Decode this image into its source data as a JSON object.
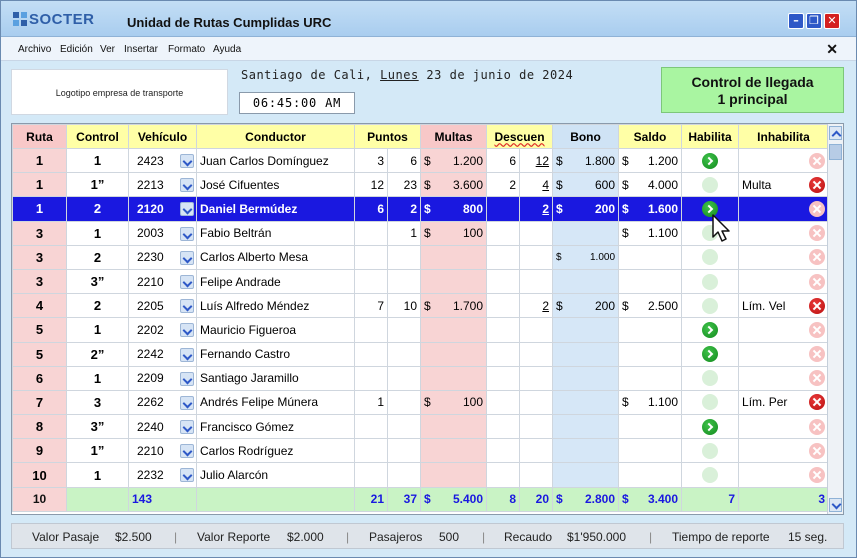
{
  "app": {
    "brand": "SOCTER",
    "title": "Unidad de Rutas Cumplidas URC",
    "window_controls": [
      "minimize",
      "maximize",
      "close"
    ]
  },
  "menu": [
    "Archivo",
    "Edición",
    "Ver",
    "Insertar",
    "Formato",
    "Ayuda"
  ],
  "header": {
    "company_logo_placeholder": "Logotipo empresa de transporte",
    "city": "Santiago de Cali,",
    "weekday": "Lunes",
    "date": "23 de junio de 2024",
    "time": "06:45:00 AM",
    "control_title_line1": "Control de llegada",
    "control_title_line2": "1 principal"
  },
  "table": {
    "columns": [
      "Ruta",
      "Control",
      "Vehículo",
      "Conductor",
      "Puntos",
      "Multas",
      "Descuen",
      "Bono",
      "Saldo",
      "Habilita",
      "Inhabilita"
    ],
    "currency_symbol": "$",
    "rows": [
      {
        "ruta": "1",
        "control": "1",
        "vehiculo": "2423",
        "conductor": "Juan Carlos Domínguez",
        "p1": "3",
        "p2": "6",
        "multa": "1.200",
        "d1": "6",
        "d2": "12",
        "bono": "1.800",
        "saldo": "1.200",
        "habilita": "on",
        "inh_text": "",
        "inh": "off"
      },
      {
        "ruta": "1",
        "control": "1”",
        "vehiculo": "2213",
        "conductor": "José Cifuentes",
        "p1": "12",
        "p2": "23",
        "multa": "3.600",
        "d1": "2",
        "d2": "4",
        "bono": "600",
        "saldo": "4.000",
        "habilita": "off",
        "inh_text": "Multa",
        "inh": "on"
      },
      {
        "ruta": "1",
        "control": "2",
        "vehiculo": "2120",
        "conductor": "Daniel Bermúdez",
        "p1": "6",
        "p2": "2",
        "multa": "800",
        "d1": "",
        "d2": "2",
        "bono": "200",
        "saldo": "1.600",
        "habilita": "on",
        "inh_text": "",
        "inh": "off",
        "selected": true
      },
      {
        "ruta": "3",
        "control": "1",
        "vehiculo": "2003",
        "conductor": "Fabio Beltrán",
        "p1": "",
        "p2": "1",
        "multa": "100",
        "d1": "",
        "d2": "",
        "bono": "",
        "saldo": "1.100",
        "habilita": "off",
        "inh_text": "",
        "inh": "off"
      },
      {
        "ruta": "3",
        "control": "2",
        "vehiculo": "2230",
        "conductor": "Carlos Alberto Mesa",
        "p1": "",
        "p2": "",
        "multa": "",
        "d1": "",
        "d2": "",
        "bono": "1.000",
        "saldo": "",
        "habilita": "off",
        "inh_text": "",
        "inh": "off"
      },
      {
        "ruta": "3",
        "control": "3”",
        "vehiculo": "2210",
        "conductor": "Felipe Andrade",
        "p1": "",
        "p2": "",
        "multa": "",
        "d1": "",
        "d2": "",
        "bono": "",
        "saldo": "",
        "habilita": "off",
        "inh_text": "",
        "inh": "off"
      },
      {
        "ruta": "4",
        "control": "2",
        "vehiculo": "2205",
        "conductor": "Luís Alfredo Méndez",
        "p1": "7",
        "p2": "10",
        "multa": "1.700",
        "d1": "",
        "d2": "2",
        "bono": "200",
        "saldo": "2.500",
        "habilita": "off",
        "inh_text": "Lím. Vel",
        "inh": "on"
      },
      {
        "ruta": "5",
        "control": "1",
        "vehiculo": "2202",
        "conductor": "Mauricio Figueroa",
        "p1": "",
        "p2": "",
        "multa": "",
        "d1": "",
        "d2": "",
        "bono": "",
        "saldo": "",
        "habilita": "on",
        "inh_text": "",
        "inh": "off"
      },
      {
        "ruta": "5",
        "control": "2”",
        "vehiculo": "2242",
        "conductor": "Fernando Castro",
        "p1": "",
        "p2": "",
        "multa": "",
        "d1": "",
        "d2": "",
        "bono": "",
        "saldo": "",
        "habilita": "on",
        "inh_text": "",
        "inh": "off"
      },
      {
        "ruta": "6",
        "control": "1",
        "vehiculo": "2209",
        "conductor": "Santiago Jaramillo",
        "p1": "",
        "p2": "",
        "multa": "",
        "d1": "",
        "d2": "",
        "bono": "",
        "saldo": "",
        "habilita": "off",
        "inh_text": "",
        "inh": "off"
      },
      {
        "ruta": "7",
        "control": "3",
        "vehiculo": "2262",
        "conductor": "Andrés Felipe Múnera",
        "p1": "1",
        "p2": "",
        "multa": "100",
        "d1": "",
        "d2": "",
        "bono": "",
        "saldo": "1.100",
        "habilita": "off",
        "inh_text": "Lím. Per",
        "inh": "on"
      },
      {
        "ruta": "8",
        "control": "3”",
        "vehiculo": "2240",
        "conductor": "Francisco Gómez",
        "p1": "",
        "p2": "",
        "multa": "",
        "d1": "",
        "d2": "",
        "bono": "",
        "saldo": "",
        "habilita": "on",
        "inh_text": "",
        "inh": "off"
      },
      {
        "ruta": "9",
        "control": "1”",
        "vehiculo": "2210",
        "conductor": "Carlos Rodríguez",
        "p1": "",
        "p2": "",
        "multa": "",
        "d1": "",
        "d2": "",
        "bono": "",
        "saldo": "",
        "habilita": "off",
        "inh_text": "",
        "inh": "off"
      },
      {
        "ruta": "10",
        "control": "1",
        "vehiculo": "2232",
        "conductor": "Julio Alarcón",
        "p1": "",
        "p2": "",
        "multa": "",
        "d1": "",
        "d2": "",
        "bono": "",
        "saldo": "",
        "habilita": "off",
        "inh_text": "",
        "inh": "off"
      }
    ],
    "totals": {
      "ruta": "10",
      "vehiculo": "143",
      "p1": "21",
      "p2": "37",
      "multa": "5.400",
      "d1": "8",
      "d2": "20",
      "bono": "2.800",
      "saldo": "3.400",
      "habilita": "7",
      "inhabilita": "3"
    }
  },
  "status": {
    "pasaje_label": "Valor Pasaje",
    "pasaje_value": "$2.500",
    "reporte_label": "Valor Reporte",
    "reporte_value": "$2.000",
    "pasajeros_label": "Pasajeros",
    "pasajeros_value": "500",
    "recaudo_label": "Recaudo",
    "recaudo_value": "$1'950.000",
    "tiempo_label": "Tiempo de reporte",
    "tiempo_value": "15 seg."
  },
  "colors": {
    "selected_row": "#1a18e0",
    "header_yellow": "#ffffa6",
    "ruta_pink": "#f8d4d4",
    "bono_blue": "#d6e7f7",
    "total_green": "#c9f3c5",
    "control_green": "#a9f5a1"
  }
}
